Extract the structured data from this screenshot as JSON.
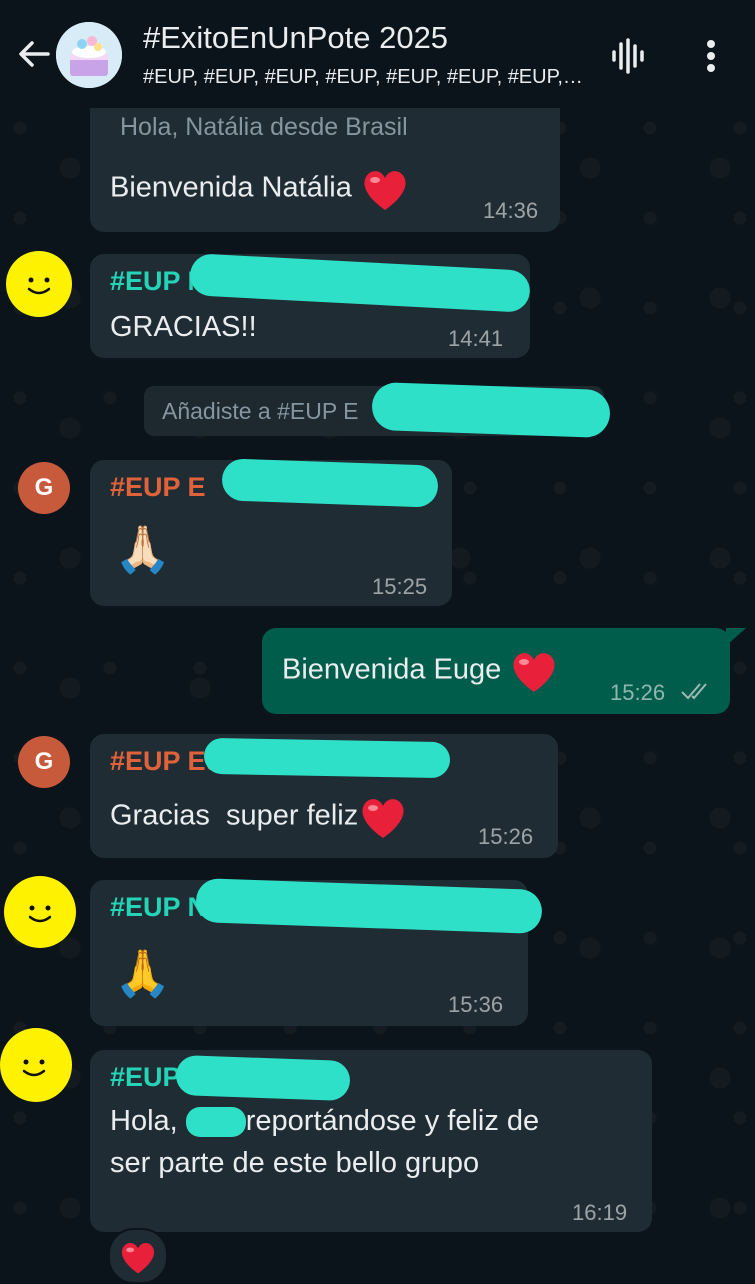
{
  "header": {
    "title": "#ExitoEnUnPote 2025",
    "subtitle": "#EUP, #EUP, #EUP, #EUP, #EUP, #EUP, #EUP, #…"
  },
  "messages": {
    "m1": {
      "quote": "Hola, Natália desde Brasil",
      "text": "Bienvenida Natália",
      "time": "14:36"
    },
    "m2": {
      "sender": "#EUP Na",
      "text": "GRACIAS!!",
      "time": "14:41"
    },
    "system": {
      "text": "Añadiste a #EUP E"
    },
    "m3": {
      "avatar_letter": "G",
      "sender": "#EUP E",
      "emoji": "🙏🏻",
      "time": "15:25"
    },
    "m4": {
      "text": "Bienvenida Euge",
      "time": "15:26"
    },
    "m5": {
      "avatar_letter": "G",
      "sender": "#EUP Eu",
      "text": "Gracias  super feliz",
      "time": "15:26"
    },
    "m6": {
      "sender": "#EUP N",
      "emoji": "🙏",
      "time": "15:36"
    },
    "m7": {
      "sender": "#EUP Y",
      "line1_a": "Hola, ",
      "line1_b": "reportándose y feliz de",
      "line2": "ser parte de este bello grupo",
      "time": "16:19"
    }
  },
  "colors": {
    "accent_teal": "#25d3b6",
    "sender_orange": "#e0623a",
    "bubble_in": "#202c33",
    "bubble_out": "#005c4b"
  }
}
